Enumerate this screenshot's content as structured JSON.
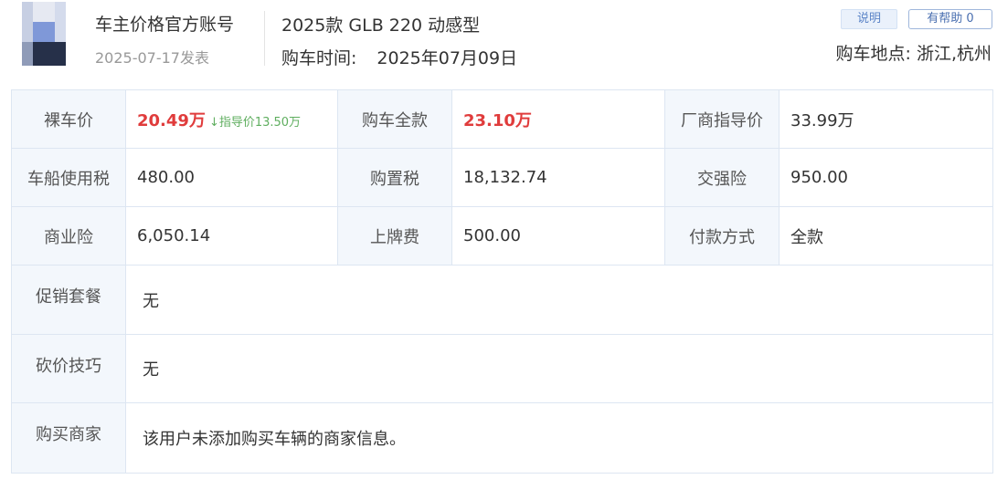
{
  "header": {
    "author": "车主价格官方账号",
    "post_date": "2025-07-17发表",
    "model": "2025款 GLB 220 动感型",
    "buy_time_label": "购车时间:",
    "buy_time_value": "2025年07月09日",
    "explain_button": "说明",
    "helpful_button": "有帮助 0",
    "location": "购车地点: 浙江,杭州"
  },
  "table": {
    "rows": [
      [
        {
          "label": "裸车价",
          "value": "20.49万",
          "guide": "↓指导价13.50万"
        },
        {
          "label": "购车全款",
          "value": "23.10万"
        },
        {
          "label": "厂商指导价",
          "value": "33.99万"
        }
      ],
      [
        {
          "label": "车船使用税",
          "value": "480.00"
        },
        {
          "label": "购置税",
          "value": "18,132.74"
        },
        {
          "label": "交强险",
          "value": "950.00"
        }
      ],
      [
        {
          "label": "商业险",
          "value": "6,050.14"
        },
        {
          "label": "上牌费",
          "value": "500.00"
        },
        {
          "label": "付款方式",
          "value": "全款"
        }
      ]
    ],
    "wide_rows": [
      {
        "label": "促销套餐",
        "value": "无"
      },
      {
        "label": "砍价技巧",
        "value": "无"
      },
      {
        "label": "购买商家",
        "value": "该用户未添加购买车辆的商家信息。"
      }
    ]
  },
  "colors": {
    "price_red": "#e03c3c",
    "guide_green": "#5fae5f",
    "label_bg": "#f3f7fc",
    "border": "#dde6f2",
    "button_blue": "#4a6fb0"
  }
}
